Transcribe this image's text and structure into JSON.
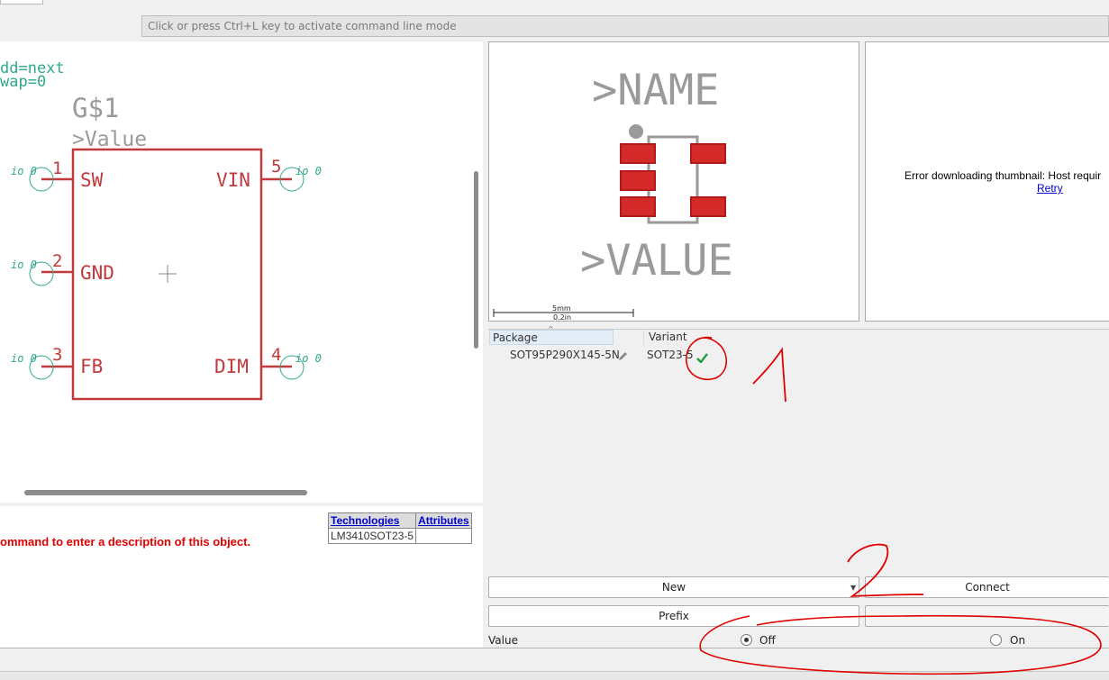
{
  "command_line": {
    "placeholder": "Click or press Ctrl+L key to activate command line mode"
  },
  "schematic": {
    "attr_line1": "dd=next",
    "attr_line2": "wap=0",
    "gate_name": "G$1",
    "value_label": ">Value",
    "pins": [
      {
        "number": "1",
        "name": "SW",
        "io": "io 0"
      },
      {
        "number": "2",
        "name": "GND",
        "io": "io 0"
      },
      {
        "number": "3",
        "name": "FB",
        "io": "io 0"
      },
      {
        "number": "5",
        "name": "VIN",
        "io": "io 0"
      },
      {
        "number": "4",
        "name": "DIM",
        "io": "io 0"
      }
    ]
  },
  "description": {
    "text": "ommand to enter a description of this object."
  },
  "tech_table": {
    "headers": [
      "Technologies",
      "Attributes"
    ],
    "rows": [
      [
        "LM3410SOT23-5",
        ""
      ]
    ]
  },
  "package_preview": {
    "name_label": ">NAME",
    "value_label": ">VALUE",
    "scale_mm": "5mm",
    "scale_in": "0.2in"
  },
  "thumbnail": {
    "error": "Error downloading thumbnail: Host requir",
    "retry": "Retry"
  },
  "package_list": {
    "columns": [
      "Package",
      "Variant"
    ],
    "rows": [
      {
        "package": "SOT95P290X145-5N",
        "variant": "SOT23-5"
      }
    ]
  },
  "buttons": {
    "new": "New",
    "connect": "Connect",
    "prefix": "Prefix"
  },
  "value_setting": {
    "label": "Value",
    "off": "Off",
    "on": "On",
    "selected": "Off"
  },
  "annotations": {
    "mark1": "1",
    "mark2": "2"
  },
  "colors": {
    "schematic_red": "#c0393b",
    "pin_teal": "#2fa98c",
    "pad_red": "#d42a2a",
    "annotation_red": "#e00000"
  }
}
